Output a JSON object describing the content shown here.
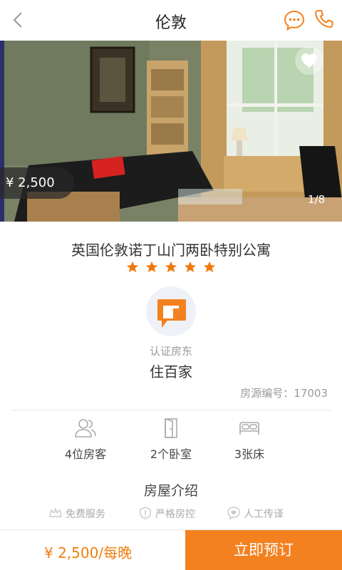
{
  "header": {
    "title": "伦敦",
    "back_icon": "chevron-left-icon",
    "message_icon": "chat-bubble-icon",
    "phone_icon": "phone-icon"
  },
  "photo": {
    "price": "¥ 2,500",
    "counter": "1/8",
    "favorite_icon": "heart-icon"
  },
  "listing": {
    "title": "英国伦敦诺丁山门两卧特别公寓",
    "stars": 5,
    "host_label": "认证房东",
    "host_name": "住百家",
    "house_no": "房源编号：17003"
  },
  "features": [
    {
      "icon": "guests-icon",
      "label": "4位房客"
    },
    {
      "icon": "door-icon",
      "label": "2个卧室"
    },
    {
      "icon": "bed-icon",
      "label": "3张床"
    }
  ],
  "intro": {
    "title": "房屋介绍",
    "services": [
      {
        "icon": "crown-icon",
        "label": "免费服务"
      },
      {
        "icon": "shield-icon",
        "label": "严格房控"
      },
      {
        "icon": "heart-chat-icon",
        "label": "人工传译"
      }
    ]
  },
  "bottom": {
    "price": "¥ 2,500/每晚",
    "book_label": "立即预订"
  },
  "colors": {
    "accent": "#f48120",
    "price_text": "#f07e10",
    "muted": "#999999"
  }
}
